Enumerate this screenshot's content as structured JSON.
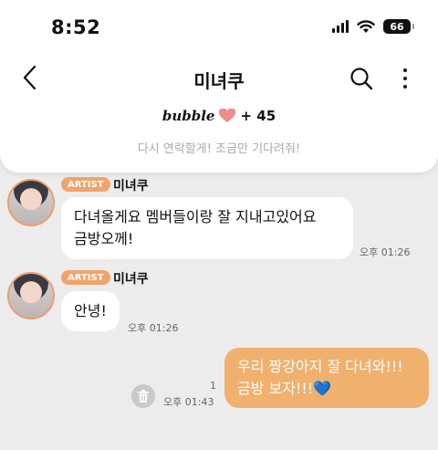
{
  "status": {
    "time": "8:52",
    "battery": "66"
  },
  "header": {
    "title": "미녀쿠",
    "bubble_logo": "bubble",
    "bubble_count": "+ 45",
    "subtitle": "다시 연락할게! 조금만 기다려줘!"
  },
  "messages": [
    {
      "badge": "ARTIST",
      "sender": "미녀쿠",
      "text_line1": "다녀올게요 멤버들이랑 잘 지내고있어요",
      "text_line2": "금방오께!",
      "time": "오후 01:26"
    },
    {
      "badge": "ARTIST",
      "sender": "미녀쿠",
      "text_line1": "안녕!",
      "time": "오후 01:26"
    }
  ],
  "my_message": {
    "text_line1": "우리 짱강아지 잘 다녀와!!!",
    "text_line2": "금방 보자!!!",
    "emoji": "💙",
    "read_count": "1",
    "time": "오후 01:43"
  },
  "colors": {
    "accent": "#f0b06e",
    "badge": "#f2a36a",
    "heart": "#f08c8c",
    "background": "#ececec"
  }
}
